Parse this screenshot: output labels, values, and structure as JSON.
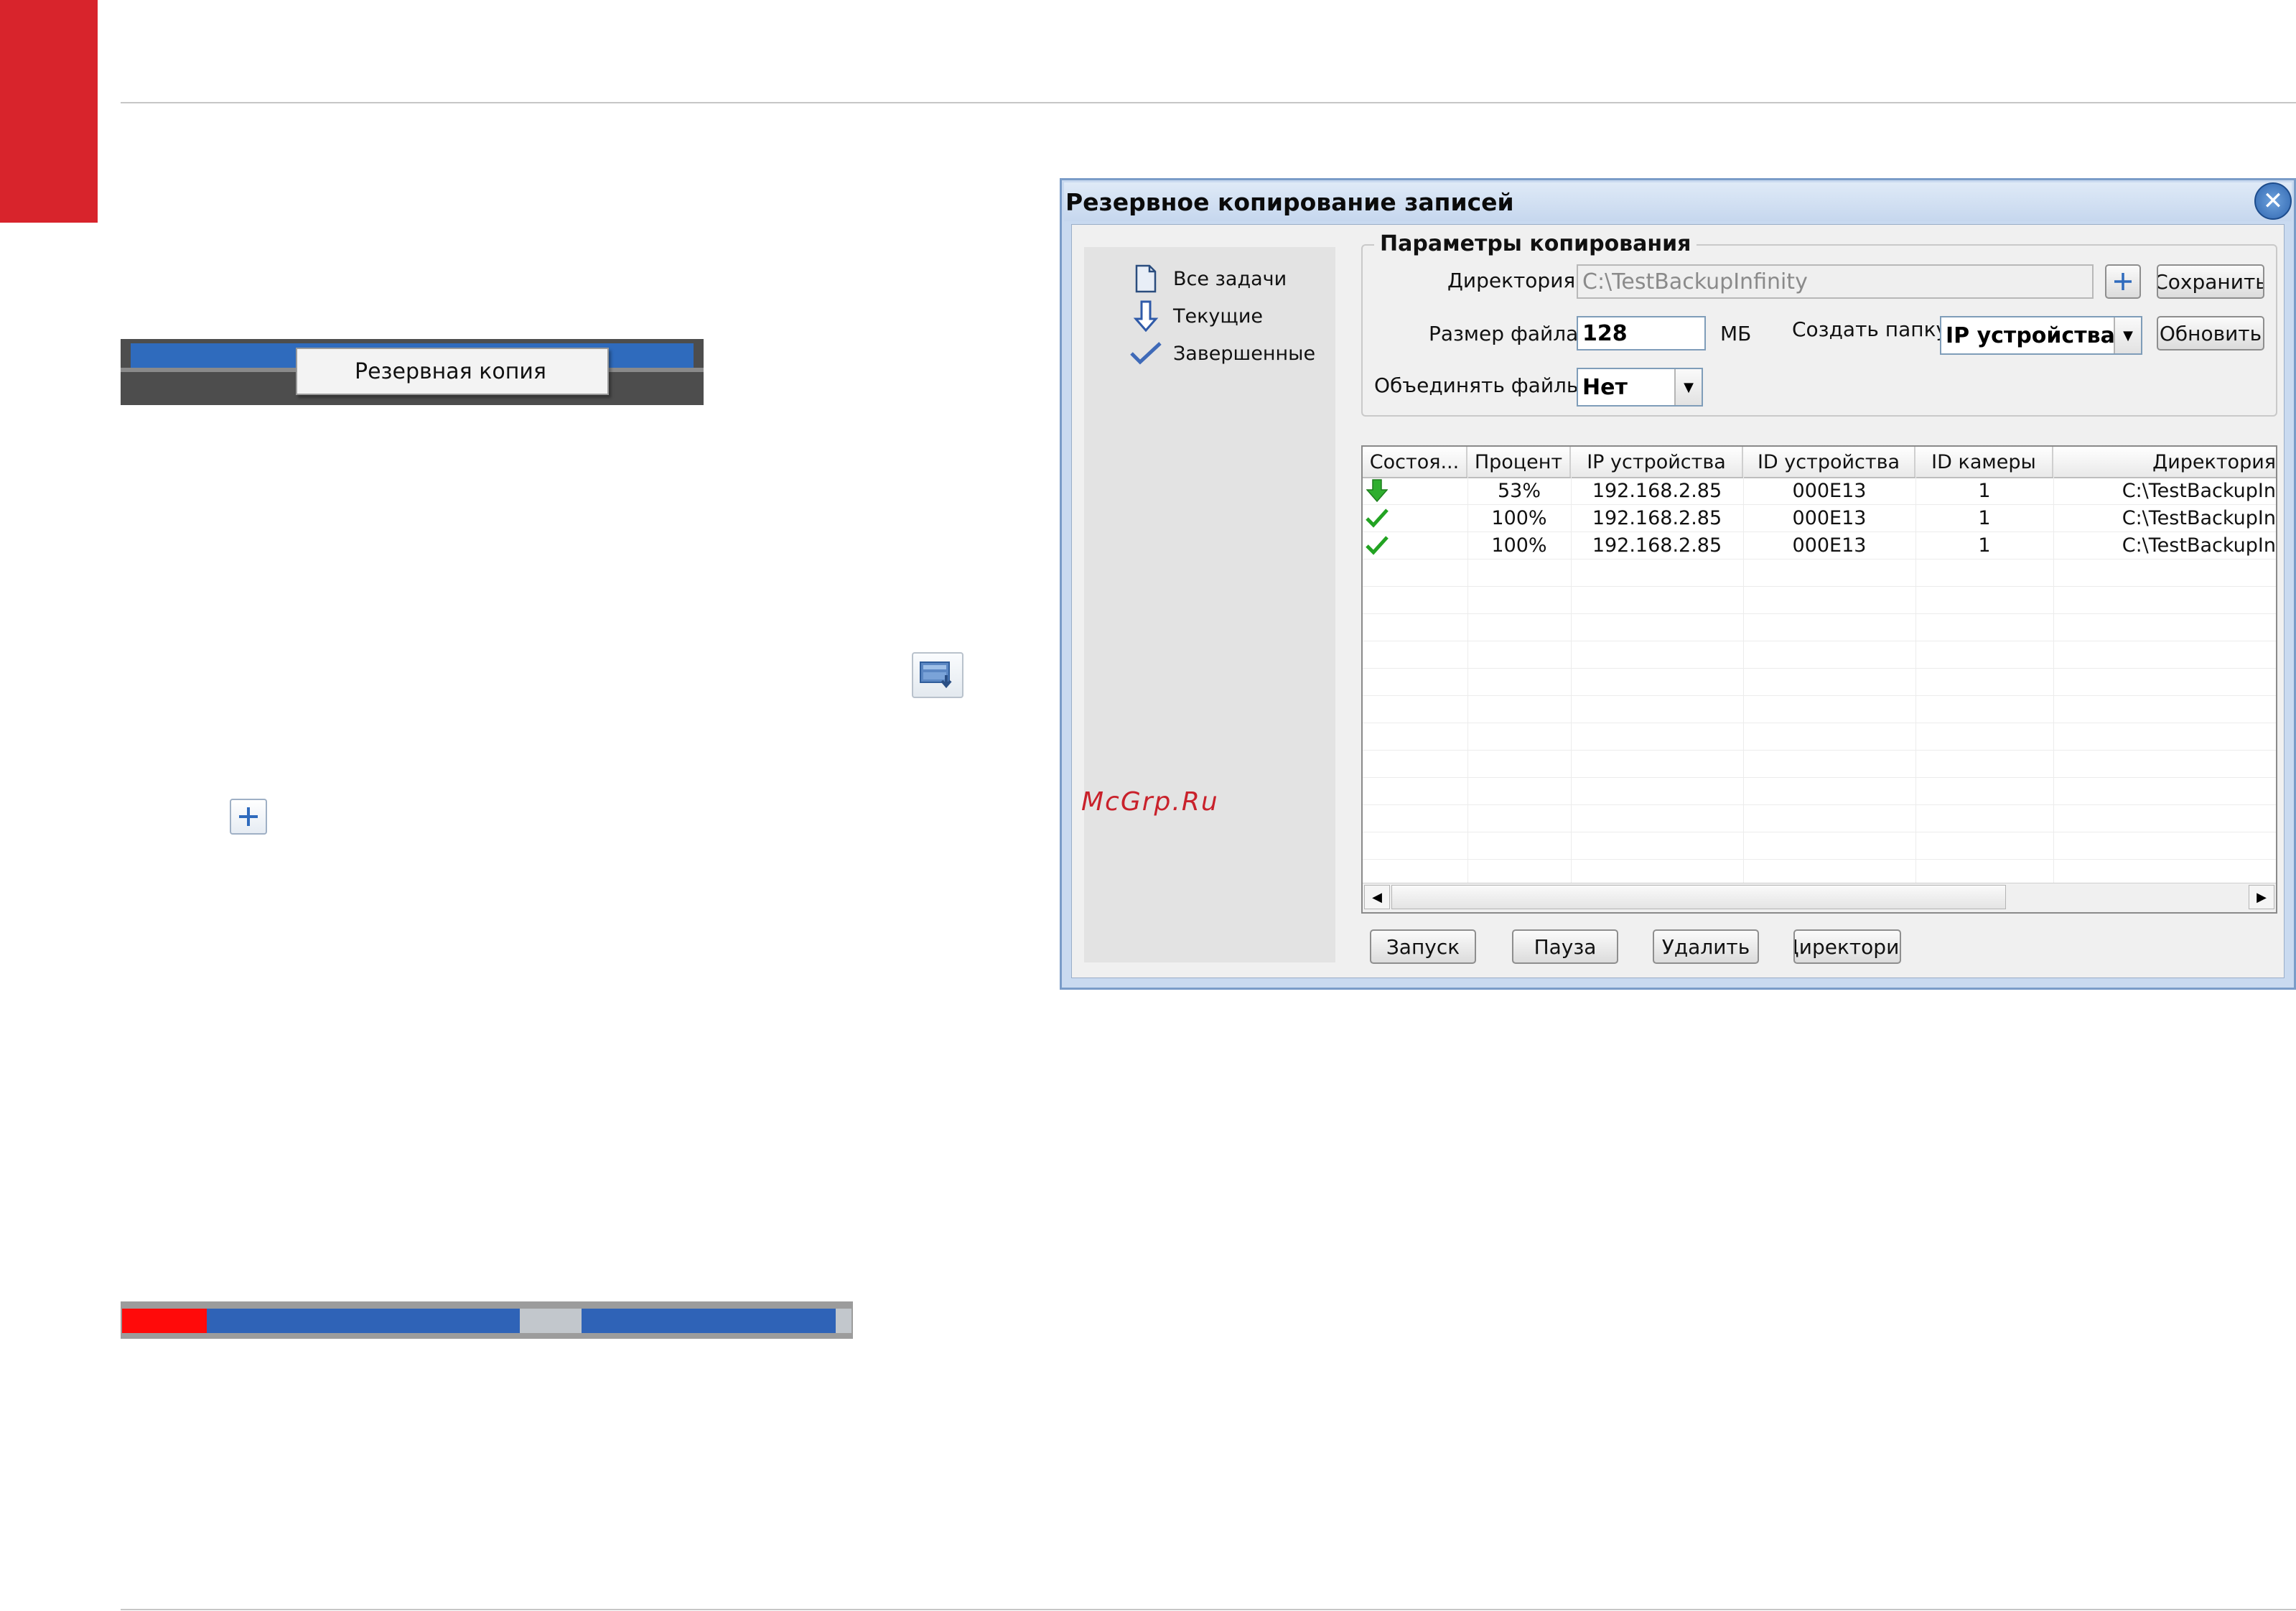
{
  "context_menu": {
    "item": "Резервная копия"
  },
  "dialog": {
    "title": "Резервное копирование записей",
    "sidebar": {
      "items": [
        {
          "label": "Все задачи",
          "icon": "document-icon"
        },
        {
          "label": "Текущие",
          "icon": "arrow-down-icon"
        },
        {
          "label": "Завершенные",
          "icon": "checkmark-icon"
        }
      ]
    },
    "watermark": "McGrp.Ru",
    "params": {
      "title": "Параметры копирования",
      "directory_label": "Директория",
      "directory_value": "C:\\TestBackupInfinity",
      "save_button": "Сохранить",
      "filesize_label": "Размер файла",
      "filesize_value": "128",
      "filesize_unit": "МБ",
      "create_folder_label": "Создать папку",
      "create_folder_value": "IP устройства",
      "refresh_button": "Обновить",
      "merge_label": "Объединять файлы",
      "merge_value": "Нет"
    },
    "table": {
      "columns": [
        "Состоя...",
        "Процент",
        "IP устройства",
        "ID устройства",
        "ID камеры",
        "Директория"
      ],
      "rows": [
        {
          "status": "downloading",
          "percent": "53%",
          "ip": "192.168.2.85",
          "device_id": "000E13",
          "camera_id": "1",
          "dir": "C:\\TestBackupIn"
        },
        {
          "status": "done",
          "percent": "100%",
          "ip": "192.168.2.85",
          "device_id": "000E13",
          "camera_id": "1",
          "dir": "C:\\TestBackupIn"
        },
        {
          "status": "done",
          "percent": "100%",
          "ip": "192.168.2.85",
          "device_id": "000E13",
          "camera_id": "1",
          "dir": "C:\\TestBackupIn"
        }
      ]
    },
    "buttons": {
      "start": "Запуск",
      "pause": "Пауза",
      "delete": "Удалить",
      "directory": "Директория"
    }
  },
  "colors": {
    "accent_red": "#d8242c",
    "timeline_blue": "#2f63b7",
    "timeline_red": "#ff0a0a"
  }
}
